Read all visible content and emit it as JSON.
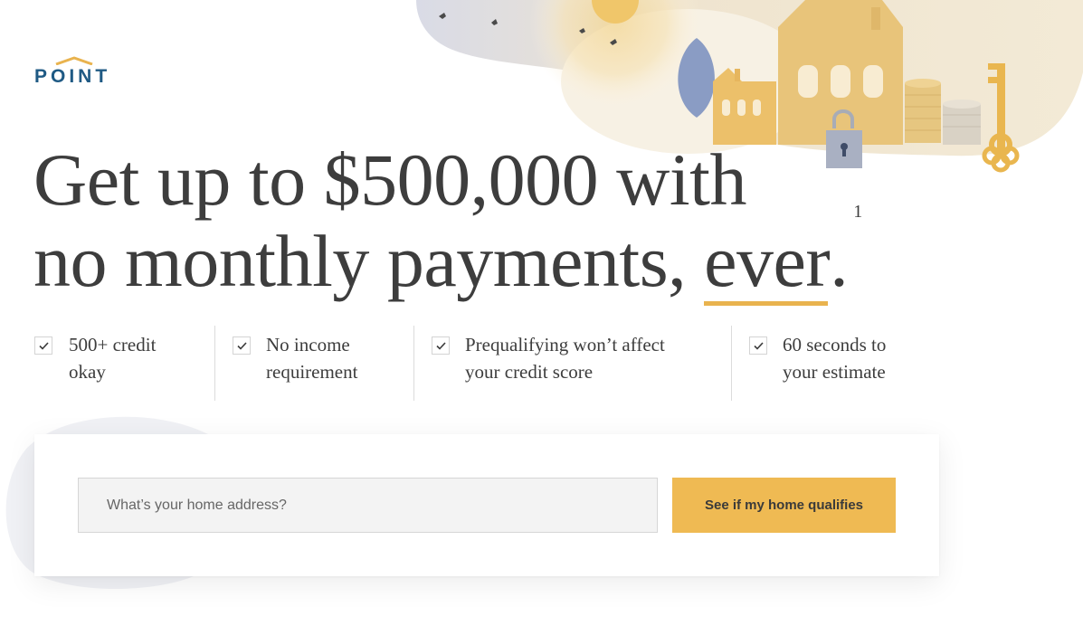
{
  "brand": {
    "name": "POINT",
    "logo_color": "#1f5a84",
    "accent_color": "#efba53"
  },
  "hero": {
    "line1": "Get up to $500,000 with",
    "line2_prefix": "no monthly payments, ",
    "emphasis_word": "ever",
    "line2_suffix": ".",
    "footnote": "1"
  },
  "features": [
    {
      "icon": "check-icon",
      "line1": "500+ credit",
      "line2": "okay"
    },
    {
      "icon": "check-icon",
      "line1": "No income",
      "line2": "requirement"
    },
    {
      "icon": "check-icon",
      "line1": "Prequalifying won’t affect",
      "line2": "your credit score"
    },
    {
      "icon": "check-icon",
      "line1": "60 seconds to",
      "line2": "your estimate"
    }
  ],
  "form": {
    "address_placeholder": "What’s your home address?",
    "address_value": "",
    "submit_label": "See if my home qualifies"
  },
  "illustration": {
    "elements": [
      "sun-icon",
      "bird-icon",
      "tree-icon",
      "house-icon",
      "padlock-icon",
      "coin-stack-icon",
      "key-icon"
    ]
  }
}
